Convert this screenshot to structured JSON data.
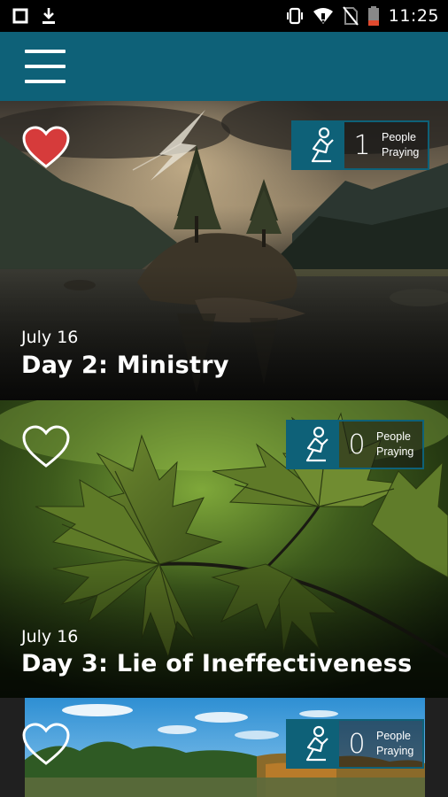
{
  "status_bar": {
    "time": "11:25",
    "icons": [
      "square-icon",
      "download-icon",
      "vibrate-icon",
      "wifi-icon",
      "no-sim-icon",
      "battery-icon"
    ]
  },
  "app_bar": {
    "menu_icon": "hamburger-menu-icon",
    "color": "#0e6178"
  },
  "devotions": [
    {
      "date": "July 16",
      "title": "Day 2: Ministry",
      "favorited": true,
      "people_praying_count": "1",
      "people_label": "People",
      "praying_label": "Praying",
      "image": "lake-storm-trees"
    },
    {
      "date": "July 16",
      "title": "Day 3: Lie of Ineffectiveness",
      "favorited": false,
      "people_praying_count": "0",
      "people_label": "People",
      "praying_label": "Praying",
      "image": "maple-leaves"
    },
    {
      "date": "",
      "title": "",
      "favorited": false,
      "people_praying_count": "0",
      "people_label": "People",
      "praying_label": "Praying",
      "image": "autumn-forest-sky"
    }
  ],
  "colors": {
    "accent": "#0e6178",
    "heart_filled": "#d63b3b",
    "text": "#ffffff"
  }
}
